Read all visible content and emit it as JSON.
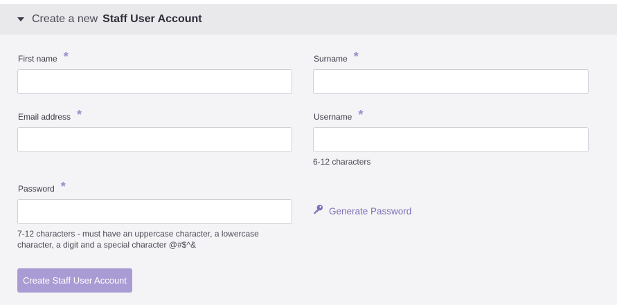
{
  "header": {
    "prefix": "Create a new",
    "title": "Staff User Account"
  },
  "form": {
    "required_marker": "*",
    "first_name": {
      "label": "First name",
      "value": "",
      "placeholder": ""
    },
    "surname": {
      "label": "Surname",
      "value": "",
      "placeholder": ""
    },
    "email": {
      "label": "Email address",
      "value": "",
      "placeholder": ""
    },
    "username": {
      "label": "Username",
      "value": "",
      "placeholder": "",
      "hint": "6-12 characters"
    },
    "password": {
      "label": "Password",
      "value": "",
      "placeholder": "",
      "hint": "7-12 characters - must have an uppercase character, a lowercase character, a digit and a special character @#$^&"
    },
    "generate_password": {
      "label": "Generate Password",
      "icon": "key-icon"
    },
    "submit_label": "Create Staff User Account"
  },
  "colors": {
    "accent": "#a99bd3",
    "link": "#7f6fb8",
    "required": "#9d8fcf"
  }
}
